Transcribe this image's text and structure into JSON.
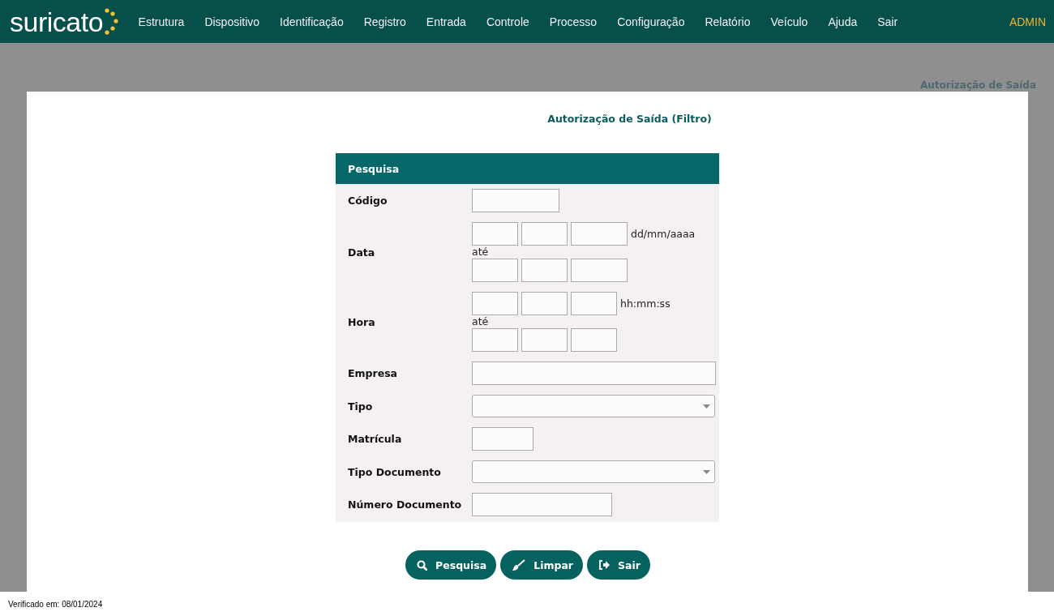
{
  "nav": {
    "logo": "suricato",
    "items": [
      "Estrutura",
      "Dispositivo",
      "Identificação",
      "Registro",
      "Entrada",
      "Controle",
      "Processo",
      "Configuração",
      "Relatório",
      "Veículo",
      "Ajuda",
      "Sair"
    ],
    "user": "ADMIN"
  },
  "breadcrumb": "Autorização de Saída",
  "page_title": "Autorização de Saída (Filtro)",
  "panel": {
    "title": "Pesquisa",
    "fields": [
      {
        "kind": "short",
        "label": "Código"
      },
      {
        "kind": "date",
        "label": "Data",
        "hint": "dd/mm/aaaa",
        "separator": "até"
      },
      {
        "kind": "time",
        "label": "Hora",
        "hint": "hh:mm:ss",
        "separator": "até"
      },
      {
        "kind": "wide",
        "label": "Empresa"
      },
      {
        "kind": "select",
        "label": "Tipo"
      },
      {
        "kind": "narrow",
        "label": "Matrícula"
      },
      {
        "kind": "select",
        "label": "Tipo Documento"
      },
      {
        "kind": "medium",
        "label": "Número Documento"
      }
    ]
  },
  "buttons": [
    {
      "kind": "search",
      "label": "Pesquisa"
    },
    {
      "kind": "clear",
      "label": "Limpar"
    },
    {
      "kind": "exit",
      "label": "Sair"
    }
  ],
  "footer": "Verificado em: 08/01/2024"
}
